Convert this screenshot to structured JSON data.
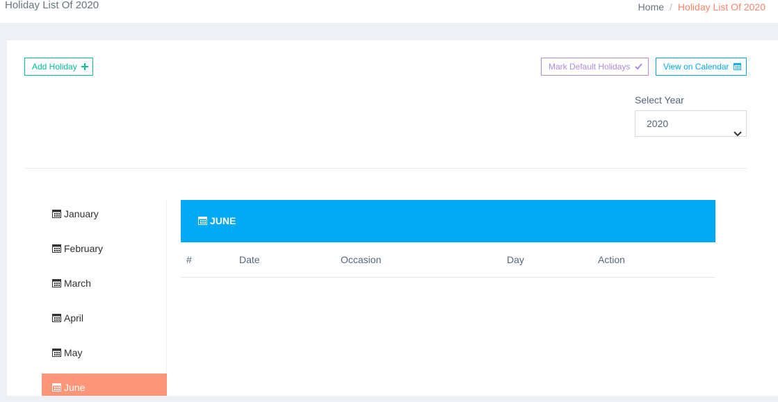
{
  "header": {
    "title": "Holiday List Of 2020",
    "breadcrumb": {
      "home": "Home",
      "separator": "/",
      "current": "Holiday List Of 2020"
    }
  },
  "toolbar": {
    "add_holiday": "Add Holiday",
    "mark_default": "Mark Default Holidays",
    "view_calendar": "View on Calendar"
  },
  "year_filter": {
    "label": "Select Year",
    "selected": "2020"
  },
  "months": [
    {
      "label": "January"
    },
    {
      "label": "February"
    },
    {
      "label": "March"
    },
    {
      "label": "April"
    },
    {
      "label": "May"
    },
    {
      "label": "June"
    }
  ],
  "active_month": "JUNE",
  "table": {
    "columns": [
      "#",
      "Date",
      "Occasion",
      "Day",
      "Action"
    ]
  },
  "colors": {
    "success": "#00c292",
    "purple": "#ab8ce4",
    "info": "#03a9f3",
    "accent": "#fb9678"
  },
  "icons": {
    "add": "plus-icon",
    "mark": "check-icon",
    "calendar": "calendar-icon",
    "select": "chevron-down-icon"
  }
}
